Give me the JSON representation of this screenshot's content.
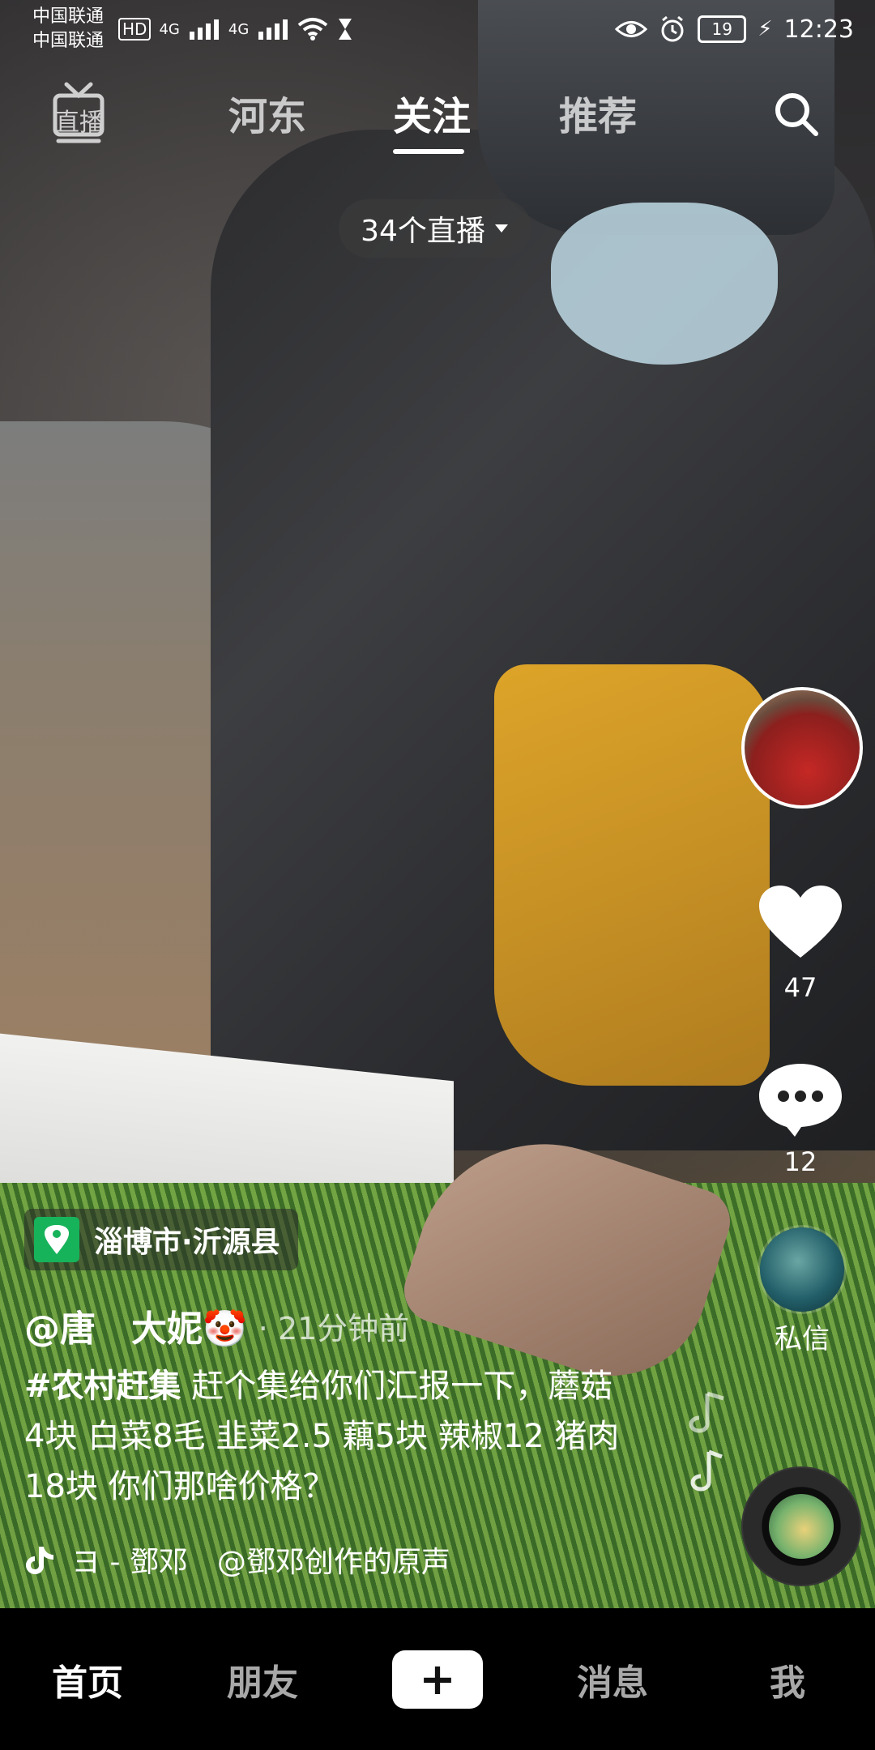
{
  "status_bar": {
    "carrier_primary": "中国联通",
    "carrier_secondary": "中国联通",
    "network_badge": "HD",
    "network_type_1": "4G",
    "network_type_2": "4G",
    "battery_level": "19",
    "time": "12:23"
  },
  "top_tabs": {
    "live_label": "直播",
    "tabs": [
      {
        "label": "河东"
      },
      {
        "label": "关注"
      },
      {
        "label": "推荐"
      }
    ],
    "active_tab": "关注"
  },
  "live_pill": {
    "label": "34个直播"
  },
  "right_rail": {
    "like_count": "47",
    "comment_count": "12",
    "dm_label": "私信"
  },
  "post": {
    "location": "淄博市·沂源县",
    "author": "@唐　大妮🤡",
    "time_ago": "· 21分钟前",
    "caption_tag": "#农村赶集",
    "caption_text": " 赶个集给你们汇报一下，蘑菇4块 白菜8毛 韭菜2.5 藕5块 辣椒12 猪肉18块 你们那啥价格？",
    "music_text": "ヨ - 鄧邓　@鄧邓创作的原声"
  },
  "bottom_nav": {
    "items": [
      {
        "label": "首页"
      },
      {
        "label": "朋友"
      },
      {
        "label": "+"
      },
      {
        "label": "消息"
      },
      {
        "label": "我"
      }
    ],
    "active": "首页"
  },
  "icons": {
    "live": "tv-icon",
    "search": "search-icon",
    "like": "heart-icon",
    "comment": "chat-bubble-icon",
    "location": "location-pin-icon",
    "music": "music-note-icon"
  }
}
